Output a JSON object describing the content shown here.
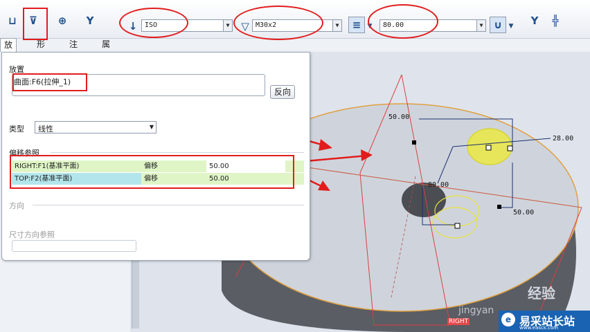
{
  "toolbar": {
    "standard_value": "ISO",
    "thread_value": "M30x2",
    "depth_value": "80.00"
  },
  "tabs": [
    "放置",
    "形状",
    "注解",
    "属性"
  ],
  "panel": {
    "placement_label": "放置",
    "surface_value": "曲面:F6(拉伸_1)",
    "flip_button": "反向",
    "type_label": "类型",
    "type_value": "线性",
    "offset_refs_label": "偏移参照",
    "offset_rows": [
      {
        "ref": "RIGHT:F1(基准平面)",
        "mode": "偏移",
        "value": "50.00"
      },
      {
        "ref": "TOP:F2(基准平面)",
        "mode": "偏移",
        "value": "50.00"
      }
    ],
    "direction_label": "方向",
    "dim_ref_label": "尺寸方向参照"
  },
  "viewport": {
    "dims": [
      "50.00",
      "28.00",
      "80.00",
      "50.00"
    ],
    "plane_label": "RIGHT",
    "watermark": "jingyan",
    "watermark2": "经验"
  },
  "branding": {
    "site_name": "易采站长站",
    "site_url": "www.easck.com"
  },
  "colors": {
    "annotation_red": "#e21c1c",
    "row_green": "#dff5c6",
    "row_cyan": "#b3e6ec",
    "model_fill": "#cfd4dc"
  }
}
